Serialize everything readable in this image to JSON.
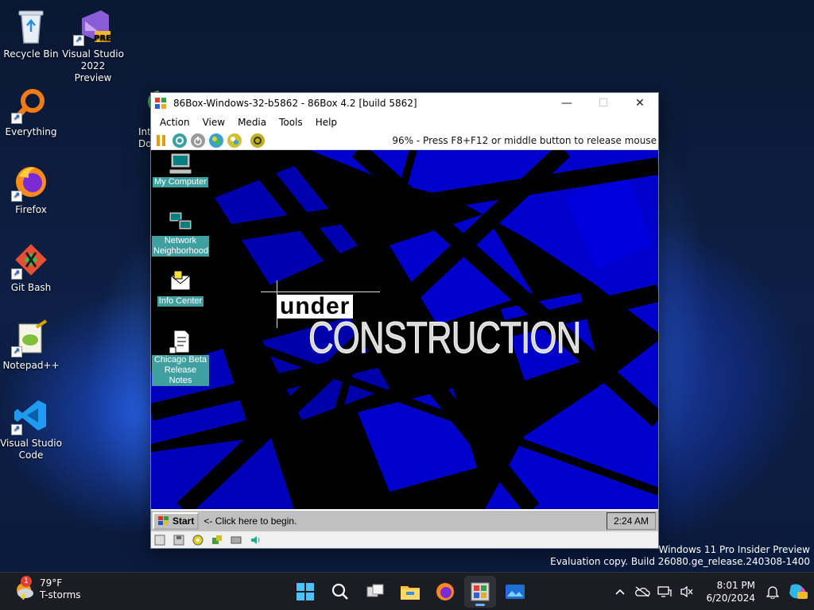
{
  "host_desktop": {
    "icons": [
      {
        "label": "Recycle Bin",
        "icon": "recycle-bin-icon"
      },
      {
        "label": "Visual Studio 2022 Preview",
        "icon": "visual-studio-preview-icon",
        "badge": "PRE"
      },
      {
        "label": "Everything",
        "icon": "everything-search-icon"
      },
      {
        "label": "Firefox",
        "icon": "firefox-icon"
      },
      {
        "label": "Git Bash",
        "icon": "git-bash-icon"
      },
      {
        "label": "Notepad++",
        "icon": "notepad-plus-plus-icon"
      },
      {
        "label": "Visual Studio Code",
        "icon": "vscode-icon"
      }
    ],
    "partial_icon_label": "Int Dow"
  },
  "vm_window": {
    "title": "86Box-Windows-32-b5862 - 86Box 4.2 [build 5862]",
    "menu": [
      "Action",
      "View",
      "Media",
      "Tools",
      "Help"
    ],
    "status_text": "96% - Press F8+F12 or middle button to release mouse",
    "guest": {
      "icons": [
        {
          "label": "My Computer"
        },
        {
          "label": "Network Neighborhood"
        },
        {
          "label": "Info Center"
        },
        {
          "label": "Chicago Beta Release Notes"
        }
      ],
      "wallpaper_word1": "under",
      "wallpaper_word2": "CONSTRUCTION",
      "start_label": "Start",
      "start_hint": "<- Click here to begin.",
      "clock": "2:24 AM"
    }
  },
  "watermark": {
    "line1": "Windows 11 Pro Insider Preview",
    "line2": "Evaluation copy. Build 26080.ge_release.240308-1400"
  },
  "taskbar": {
    "weather_temp": "79°F",
    "weather_desc": "T-storms",
    "weather_badge": "1",
    "time": "8:01 PM",
    "date": "6/20/2024",
    "apps": [
      "start-button",
      "search-button",
      "task-view-button",
      "file-explorer-button",
      "firefox-button",
      "86box-button",
      "photos-button"
    ],
    "colors": {
      "accent": "#6cb6ff",
      "guest_desktop_teal": "#40a0a0",
      "wallpaper_blue": "#0000cc"
    }
  }
}
